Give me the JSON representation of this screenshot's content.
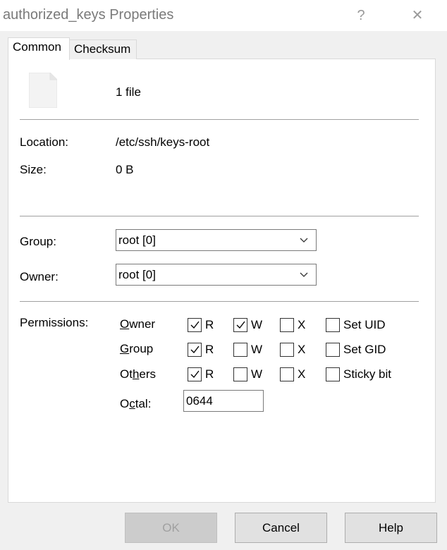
{
  "window": {
    "title": "authorized_keys Properties",
    "help_glyph": "?",
    "close_glyph": "✕"
  },
  "tabs": [
    {
      "label": "Common",
      "active": true
    },
    {
      "label": "Checksum",
      "active": false
    }
  ],
  "summary": {
    "file_count": "1 file"
  },
  "info": {
    "location_label": "Location:",
    "location_value": "/etc/ssh/keys-root",
    "size_label": "Size:",
    "size_value": "0 B"
  },
  "group": {
    "label": "Group:",
    "value": "root [0]"
  },
  "owner": {
    "label": "Owner:",
    "value": "root [0]"
  },
  "permissions": {
    "label": "Permissions:",
    "rows": [
      {
        "label_pre": "",
        "label_ul": "O",
        "label_post": "wner",
        "r": true,
        "w": true,
        "x": false,
        "special_label": "Set UID",
        "special": false
      },
      {
        "label_pre": "",
        "label_ul": "G",
        "label_post": "roup",
        "r": true,
        "w": false,
        "x": false,
        "special_label": "Set GID",
        "special": false
      },
      {
        "label_pre": "Ot",
        "label_ul": "h",
        "label_post": "ers",
        "r": true,
        "w": false,
        "x": false,
        "special_label": "Sticky bit",
        "special": false
      }
    ],
    "r_label": "R",
    "w_label": "W",
    "x_label": "X",
    "octal_label_pre": "O",
    "octal_label_ul": "c",
    "octal_label_post": "tal:",
    "octal_value": "0644"
  },
  "buttons": {
    "ok": "OK",
    "cancel": "Cancel",
    "help": "Help"
  }
}
